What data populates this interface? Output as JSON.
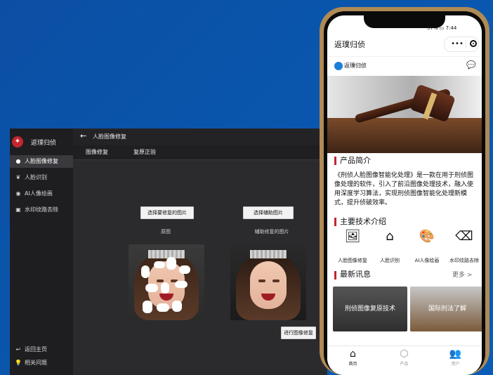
{
  "desktop": {
    "brand": "返璞归侦",
    "nav": [
      {
        "label": "人脸图像修复",
        "icon": "circle-icon",
        "active": true
      },
      {
        "label": "人脸识别",
        "icon": "leaf-icon",
        "active": false
      },
      {
        "label": "AI人像绘画",
        "icon": "palette-icon",
        "active": false
      },
      {
        "label": "水印纹路去除",
        "icon": "image-icon",
        "active": false
      }
    ],
    "bottom_nav": [
      {
        "label": "返回主页",
        "icon": "back-arrow-icon"
      },
      {
        "label": "相关问题",
        "icon": "bulb-icon"
      }
    ],
    "page_title": "人脸图像修复",
    "tabs": [
      "图像修复",
      "复原正验"
    ],
    "buttons": {
      "select_repair": "选择要修复的图片",
      "select_aux": "选择辅助图片",
      "run_repair": "进行图像修复"
    },
    "captions": {
      "original": "原图",
      "aux": "辅助修复的图片"
    }
  },
  "phone": {
    "status_right": "57%",
    "time": "7:44",
    "title": "返璞归侦",
    "capsule_more": "•••",
    "brand_text": "返璞归侦",
    "sections": {
      "intro_title": "产品简介",
      "intro_text": "《刑侦人脸图像智能化处理》是一款在用于刑侦图像处理的软件，引入了前沿图像处理技术，融入使用深度学习算法，实现刑侦图像智能化处理新模式，提升侦破效率。",
      "tech_title": "主要技术介绍",
      "news_title": "最新讯息",
      "more": "更多 >"
    },
    "features": [
      {
        "label": "人脸图像修复",
        "icon": "image-edit-icon"
      },
      {
        "label": "人脸识别",
        "icon": "face-scan-icon"
      },
      {
        "label": "AI人像绘画",
        "icon": "palette-icon"
      },
      {
        "label": "水印纹路去除",
        "icon": "eraser-icon"
      }
    ],
    "cards": [
      {
        "label": "刑侦图像复原技术"
      },
      {
        "label": "国际刑法了解"
      }
    ],
    "tabbar": [
      {
        "label": "首页",
        "icon": "home-icon",
        "active": true
      },
      {
        "label": "产品",
        "icon": "box-icon",
        "active": false
      },
      {
        "label": "用户",
        "icon": "users-icon",
        "active": false
      }
    ]
  }
}
